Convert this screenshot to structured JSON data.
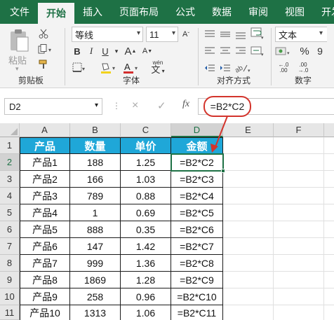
{
  "tabs": [
    "文件",
    "开始",
    "插入",
    "页面布局",
    "公式",
    "数据",
    "审阅",
    "视图",
    "开发"
  ],
  "ribbon": {
    "clipboard": {
      "paste_label": "粘贴",
      "group_label": "剪贴板"
    },
    "font": {
      "font_name": "等线",
      "font_size": "11",
      "group_label": "字体",
      "bold": "B",
      "italic": "I",
      "underline": "U",
      "grow": "A",
      "shrink": "A",
      "phonetic": "wén"
    },
    "alignment": {
      "group_label": "对齐方式"
    },
    "number": {
      "format": "文本",
      "percent": "%",
      "comma": "9",
      "group_label": "数字"
    }
  },
  "formula_bar": {
    "name_box": "D2",
    "cancel": "×",
    "enter": "✓",
    "fx": "fx",
    "formula": "=B2*C2"
  },
  "columns": [
    "A",
    "B",
    "C",
    "D",
    "E",
    "F"
  ],
  "rows": [
    "1",
    "2",
    "3",
    "4",
    "5",
    "6",
    "7",
    "8",
    "9",
    "10",
    "11"
  ],
  "table": {
    "headers": [
      "产品",
      "数量",
      "单价",
      "金额"
    ],
    "rows": [
      [
        "产品1",
        "188",
        "1.25",
        "=B2*C2"
      ],
      [
        "产品2",
        "166",
        "1.03",
        "=B2*C3"
      ],
      [
        "产品3",
        "789",
        "0.88",
        "=B2*C4"
      ],
      [
        "产品4",
        "1",
        "0.69",
        "=B2*C5"
      ],
      [
        "产品5",
        "888",
        "0.35",
        "=B2*C6"
      ],
      [
        "产品6",
        "147",
        "1.42",
        "=B2*C7"
      ],
      [
        "产品7",
        "999",
        "1.36",
        "=B2*C8"
      ],
      [
        "产品8",
        "1869",
        "1.28",
        "=B2*C9"
      ],
      [
        "产品9",
        "258",
        "0.96",
        "=B2*C10"
      ],
      [
        "产品10",
        "1313",
        "1.06",
        "=B2*C11"
      ]
    ]
  },
  "colors": {
    "ribbon_green": "#1e7145",
    "header_blue": "#1fa7d8",
    "annotation_red": "#d3342c"
  }
}
